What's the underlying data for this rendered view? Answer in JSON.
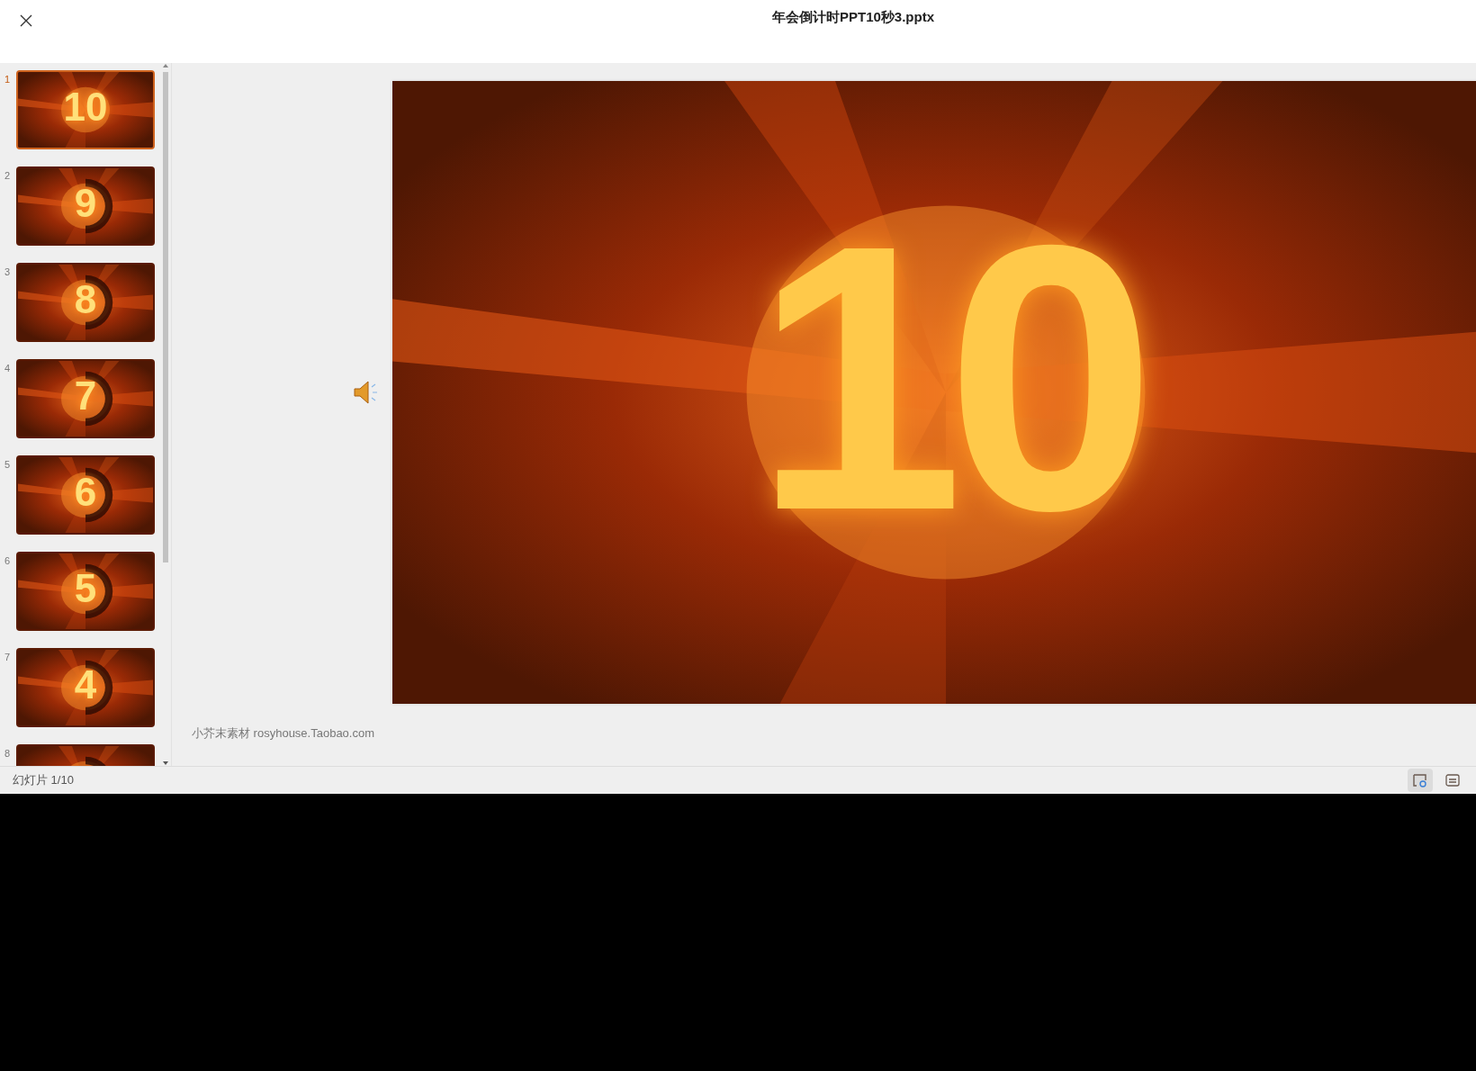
{
  "window": {
    "title": "年会倒计时PPT10秒3.pptx"
  },
  "slides": [
    {
      "number": "1",
      "digit": "10",
      "selected": true
    },
    {
      "number": "2",
      "digit": "9",
      "selected": false
    },
    {
      "number": "3",
      "digit": "8",
      "selected": false
    },
    {
      "number": "4",
      "digit": "7",
      "selected": false
    },
    {
      "number": "5",
      "digit": "6",
      "selected": false
    },
    {
      "number": "6",
      "digit": "5",
      "selected": false
    },
    {
      "number": "7",
      "digit": "4",
      "selected": false
    },
    {
      "number": "8",
      "selected": false
    }
  ],
  "current_slide": {
    "kind": "picture",
    "digit": "10"
  },
  "notes": "小芥末素材 rosyhouse.Taobao.com",
  "status_bar": {
    "slide_counter": "幻灯片 1/10",
    "view_buttons": [
      {
        "kind": "notes",
        "selected": true
      },
      {
        "kind": "comments",
        "selected": false
      }
    ]
  }
}
